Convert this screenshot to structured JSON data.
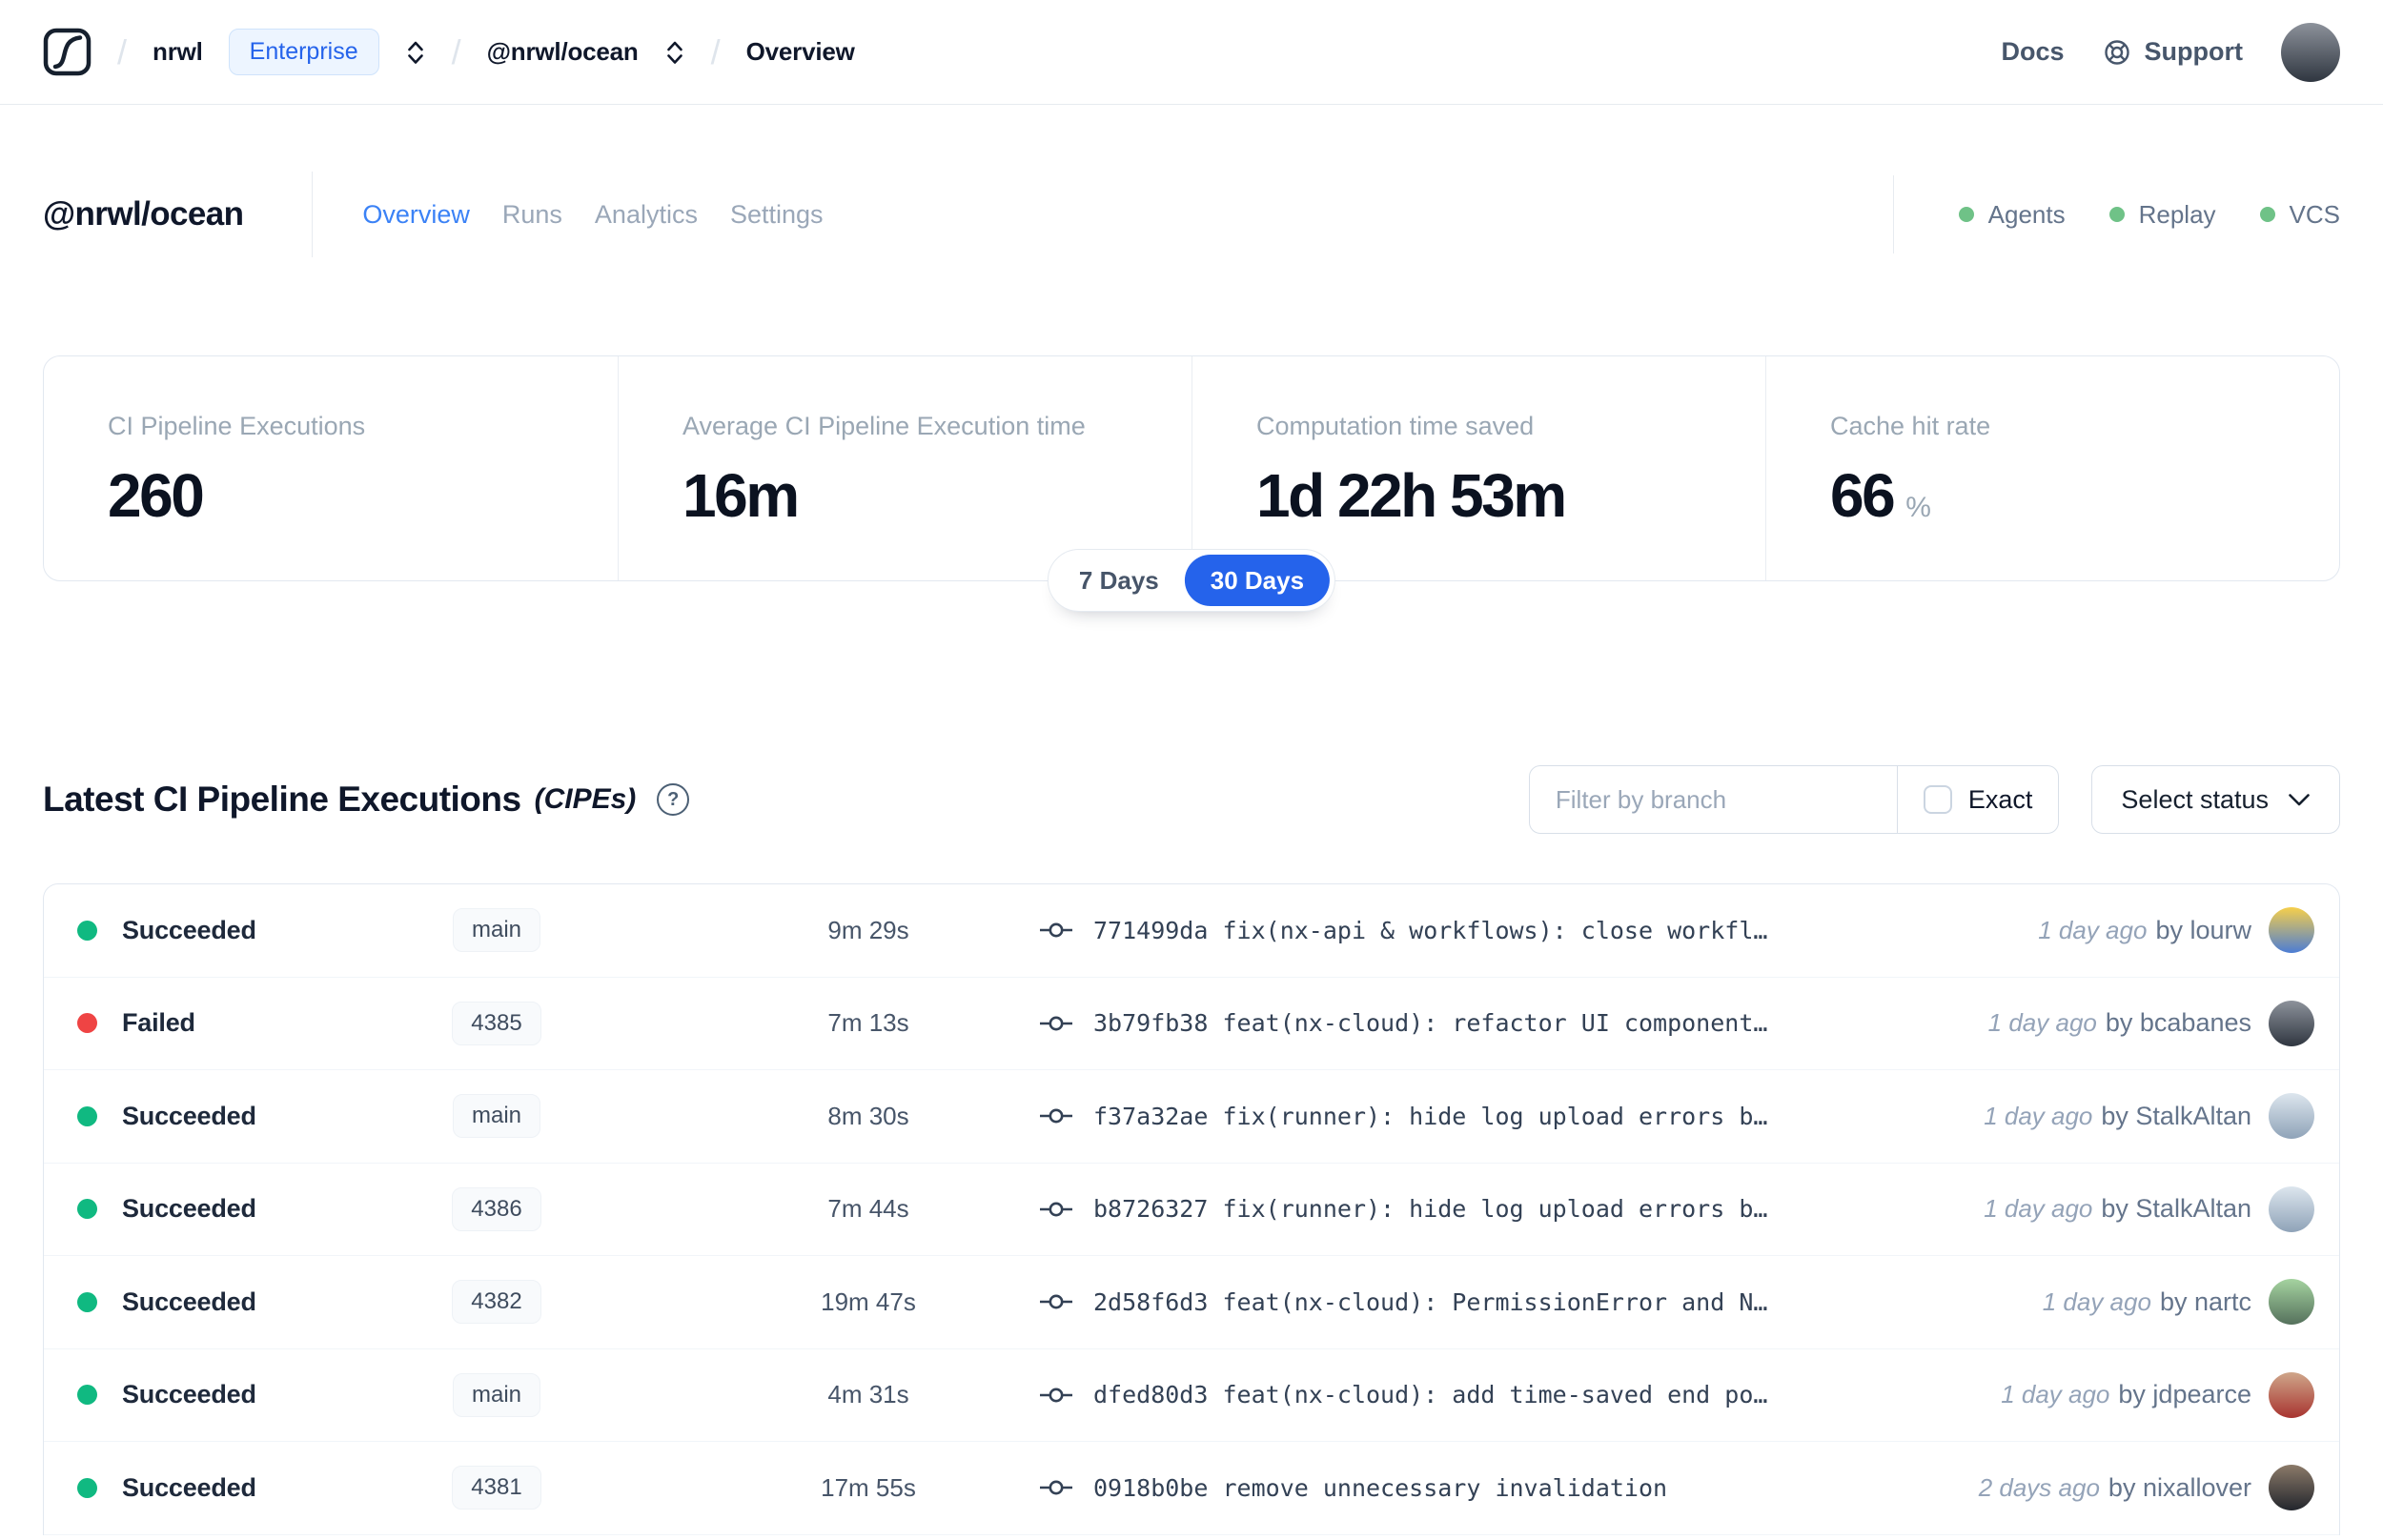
{
  "colors": {
    "accent_blue": "#2563eb",
    "tab_active_blue": "#3b82f6",
    "online_dot_green": "#6fc287",
    "status_dot": {
      "Succeeded": "#10b981",
      "Failed": "#ef4444"
    }
  },
  "navbar": {
    "breadcrumb_separator": "/",
    "org": "nrwl",
    "plan_badge": "Enterprise",
    "workspace": "@nrwl/ocean",
    "page": "Overview",
    "docs_link": "Docs",
    "support_link": "Support",
    "avatar_colors": [
      "#8d929b",
      "#2f3640"
    ]
  },
  "header": {
    "title": "@nrwl/ocean",
    "active_tab_index": 0,
    "tabs": [
      {
        "label": "Overview"
      },
      {
        "label": "Runs"
      },
      {
        "label": "Analytics"
      },
      {
        "label": "Settings"
      }
    ],
    "statuses": [
      {
        "label": "Agents"
      },
      {
        "label": "Replay"
      },
      {
        "label": "VCS"
      }
    ]
  },
  "stats": {
    "cards": [
      {
        "label": "CI Pipeline Executions",
        "value": "260"
      },
      {
        "label": "Average CI Pipeline Execution time",
        "value": "16m"
      },
      {
        "label": "Computation time saved",
        "value": "1d 22h 53m"
      },
      {
        "label": "Cache hit rate",
        "value": "66",
        "suffix": "%"
      }
    ]
  },
  "time_range": {
    "options": [
      "7 Days",
      "30 Days"
    ],
    "active_index": 1
  },
  "section": {
    "title": "Latest CI Pipeline Executions",
    "subtitle": "(CIPEs)",
    "help_glyph": "?"
  },
  "filters": {
    "branch_placeholder": "Filter by branch",
    "exact_label": "Exact",
    "status_button_label": "Select status"
  },
  "table": {
    "rows": [
      {
        "status": "Succeeded",
        "branch": "main",
        "duration": "9m 29s",
        "hash": "771499da",
        "message": "fix(nx-api & workflows): close workfl…",
        "time_ago": "1 day ago",
        "author": "by lourw",
        "avatar": [
          "#f6cf4b",
          "#4c7dd4"
        ]
      },
      {
        "status": "Failed",
        "branch": "4385",
        "duration": "7m 13s",
        "hash": "3b79fb38",
        "message": "feat(nx-cloud): refactor UI component…",
        "time_ago": "1 day ago",
        "author": "by bcabanes",
        "avatar": [
          "#8d929b",
          "#2f3640"
        ]
      },
      {
        "status": "Succeeded",
        "branch": "main",
        "duration": "8m 30s",
        "hash": "f37a32ae",
        "message": "fix(runner): hide log upload errors b…",
        "time_ago": "1 day ago",
        "author": "by StalkAltan",
        "avatar": [
          "#dde6ee",
          "#8fa3b8"
        ]
      },
      {
        "status": "Succeeded",
        "branch": "4386",
        "duration": "7m 44s",
        "hash": "b8726327",
        "message": "fix(runner): hide log upload errors b…",
        "time_ago": "1 day ago",
        "author": "by StalkAltan",
        "avatar": [
          "#dde6ee",
          "#8fa3b8"
        ]
      },
      {
        "status": "Succeeded",
        "branch": "4382",
        "duration": "19m 47s",
        "hash": "2d58f6d3",
        "message": "feat(nx-cloud): PermissionError and N…",
        "time_ago": "1 day ago",
        "author": "by nartc",
        "avatar": [
          "#a5d3a0",
          "#55715c"
        ]
      },
      {
        "status": "Succeeded",
        "branch": "main",
        "duration": "4m 31s",
        "hash": "dfed80d3",
        "message": "feat(nx-cloud): add time-saved end po…",
        "time_ago": "1 day ago",
        "author": "by jdpearce",
        "avatar": [
          "#cfa68a",
          "#a83430"
        ]
      },
      {
        "status": "Succeeded",
        "branch": "4381",
        "duration": "17m 55s",
        "hash": "0918b0be",
        "message": "remove unnecessary invalidation",
        "time_ago": "2 days ago",
        "author": "by nixallover",
        "avatar": [
          "#8b7a69",
          "#23262d"
        ]
      }
    ]
  }
}
